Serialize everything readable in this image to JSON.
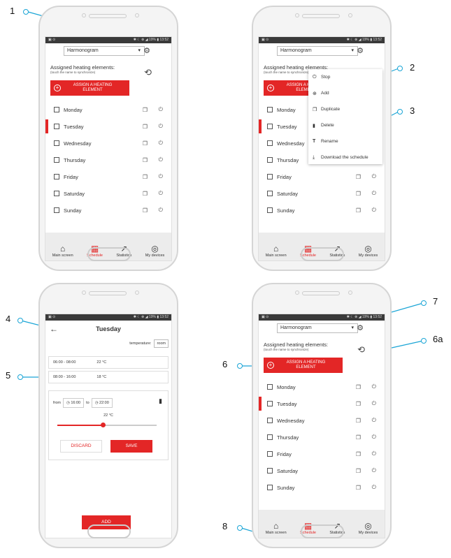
{
  "callouts": [
    "1",
    "2",
    "3",
    "4",
    "5",
    "6",
    "6a",
    "7",
    "8"
  ],
  "status": {
    "left": "▣ ⊙",
    "right": "✱ ☾ ⊗ ◢ 19% ▮ 13:52"
  },
  "schedule_screen": {
    "dropdown_value": "Harmonogram",
    "assigned_title": "Assigned heating elements:",
    "assigned_hint": "(touch the name to synchronize)",
    "assign_button": "ASSIGN A HEATING ELEMENT",
    "days": [
      "Monday",
      "Tuesday",
      "Wednesday",
      "Thursday",
      "Friday",
      "Saturday",
      "Sunday"
    ],
    "active_day_index": 1
  },
  "nav": [
    {
      "label": "Main screen",
      "icon": "home-icon"
    },
    {
      "label": "Schedule",
      "icon": "calendar-icon"
    },
    {
      "label": "Statistics",
      "icon": "chart-icon"
    },
    {
      "label": "My devices",
      "icon": "device-icon"
    }
  ],
  "menu": [
    "Stop",
    "Add",
    "Duplicate",
    "Delete",
    "Rename",
    "Download the schedule"
  ],
  "day_editor": {
    "title": "Tuesday",
    "temperature_label": "temperature:",
    "temperature_value": "room",
    "periods": [
      {
        "range": "06:00 - 08:00",
        "temp": "22 °C"
      },
      {
        "range": "08:00 - 16:00",
        "temp": "18 °C"
      }
    ],
    "from_label": "from",
    "from_time": "16:00",
    "to_label": "to",
    "to_time": "22:00",
    "slider_value": "22 °C",
    "slider_fraction": 0.46,
    "discard": "DISCARD",
    "save": "SAVE",
    "add": "ADD"
  },
  "colors": {
    "accent": "#e32626",
    "callout": "#1aa5d6"
  }
}
